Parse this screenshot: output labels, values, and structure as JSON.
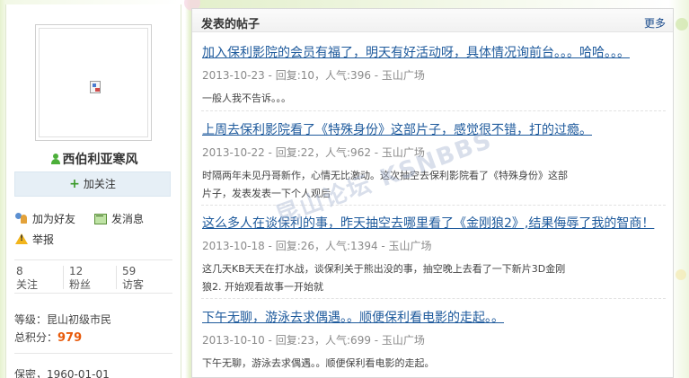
{
  "profile": {
    "username": "西伯利亚寒风",
    "follow_label": "加关注",
    "actions": {
      "add_friend": "加为好友",
      "send_message": "发消息",
      "report": "举报"
    },
    "stats": [
      {
        "count": "8",
        "label": "关注"
      },
      {
        "count": "12",
        "label": "粉丝"
      },
      {
        "count": "59",
        "label": "访客"
      }
    ],
    "level_text": "等级：昆山初级市民",
    "score_label": "总积分：",
    "score_value": "979",
    "birth_text": "保密，1960-01-01"
  },
  "posts_panel": {
    "title": "发表的帖子",
    "more_label": "更多",
    "posts": [
      {
        "title": "加入保利影院的会员有福了，明天有好活动呀，具体情况询前台。。。哈哈。。。",
        "meta": "2013-10-23 - 回复:10，人气:396 - 玉山广场",
        "excerpt": "一般人我不告诉。。。"
      },
      {
        "title": "上周去保利影院看了《特殊身份》这部片子，感觉很不错，打的过瘾。",
        "meta": "2013-10-22 - 回复:22，人气:962 - 玉山广场",
        "excerpt": "时隔两年未见丹哥新作，心情无比激动。这次抽空去保利影院看了《特殊身份》这部片子，发表发表一下个人观后"
      },
      {
        "title": "这么多人在谈保利的事，昨天抽空去哪里看了《金刚狼2》,结果侮辱了我的智商！",
        "meta": "2013-10-18 - 回复:26，人气:1394 - 玉山广场",
        "excerpt": "这几天KB天天在打水战，谈保利关于熊出没的事，抽空晚上去看了一下新片3D金刚狼2. 开始观看故事一开始就"
      },
      {
        "title": "下午无聊，游泳去求偶遇。。顺便保利看电影的走起。。",
        "meta": "2013-10-10 - 回复:23，人气:699 - 玉山广场",
        "excerpt": "下午无聊，游泳去求偶遇。。顺便保利看电影的走起。"
      }
    ]
  },
  "watermark_text": "昆山论坛 KSNBBS",
  "colors": {
    "link": "#1e5a9c",
    "score": "#e85b0c",
    "page_bg": "#eaf4d8",
    "follow_bg": "#e6eff6"
  }
}
